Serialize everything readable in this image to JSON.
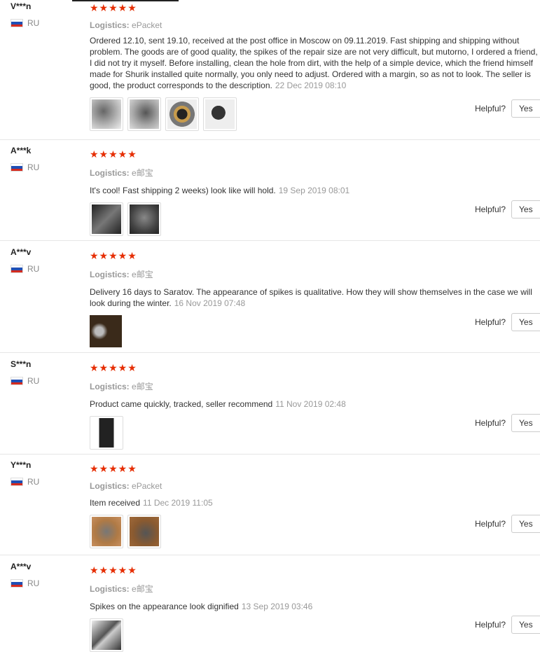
{
  "reviews": [
    {
      "user": "V***n",
      "country": "RU",
      "logistics_label": "Logistics:",
      "logistics": "ePacket",
      "text": "Ordered 12.10, sent 19.10, received at the post office in Moscow on 09.11.2019. Fast shipping and shipping without problem. The goods are of good quality, the spikes of the repair size are not very difficult, but mutorno, I ordered a friend, I did not try it myself. Before installing, clean the hole from dirt, with the help of a simple device, which the friend himself made for Shurik installed quite normally, you only need to adjust. Ordered with a margin, so as not to look. The seller is good, the product corresponds to the description.",
      "date": "22 Dec 2019 08:10",
      "stars": "★★★★★",
      "thumbs": 4,
      "helpful": "Helpful?",
      "yes": "Yes"
    },
    {
      "user": "A***k",
      "country": "RU",
      "logistics_label": "Logistics:",
      "logistics": "e邮宝",
      "text": "It's cool! Fast shipping 2 weeks) look like will hold.",
      "date": "19 Sep 2019 08:01",
      "stars": "★★★★★",
      "thumbs": 2,
      "helpful": "Helpful?",
      "yes": "Yes"
    },
    {
      "user": "A***v",
      "country": "RU",
      "logistics_label": "Logistics:",
      "logistics": "e邮宝",
      "text": "Delivery 16 days to Saratov. The appearance of spikes is qualitative. How they will show themselves in the case we will look during the winter.",
      "date": "16 Nov 2019 07:48",
      "stars": "★★★★★",
      "thumbs": 1,
      "helpful": "Helpful?",
      "yes": "Yes"
    },
    {
      "user": "S***n",
      "country": "RU",
      "logistics_label": "Logistics:",
      "logistics": "e邮宝",
      "text": "Product came quickly, tracked, seller recommend",
      "date": "11 Nov 2019 02:48",
      "stars": "★★★★★",
      "thumbs": 1,
      "helpful": "Helpful?",
      "yes": "Yes"
    },
    {
      "user": "Y***n",
      "country": "RU",
      "logistics_label": "Logistics:",
      "logistics": "ePacket",
      "text": "Item received",
      "date": "11 Dec 2019 11:05",
      "stars": "★★★★★",
      "thumbs": 2,
      "helpful": "Helpful?",
      "yes": "Yes"
    },
    {
      "user": "A***v",
      "country": "RU",
      "logistics_label": "Logistics:",
      "logistics": "e邮宝",
      "text": "Spikes on the appearance look dignified",
      "date": "13 Sep 2019 03:46",
      "stars": "★★★★★",
      "thumbs": 1,
      "helpful": "Helpful?",
      "yes": "Yes"
    }
  ],
  "colors": {
    "star": "#e62e04",
    "muted": "#999999",
    "text": "#333333"
  }
}
